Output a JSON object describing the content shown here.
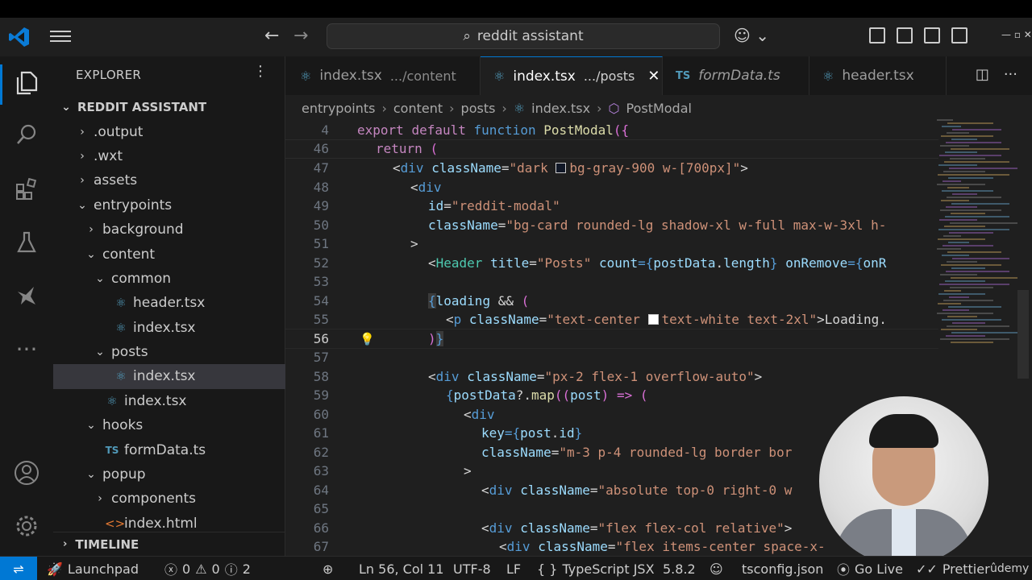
{
  "titlebar": {
    "search": "reddit assistant"
  },
  "explorer": {
    "header": "EXPLORER",
    "root": "REDDIT ASSISTANT",
    "items": [
      {
        "label": ".output",
        "depth": 0,
        "kind": "folder",
        "open": false
      },
      {
        "label": ".wxt",
        "depth": 0,
        "kind": "folder",
        "open": false
      },
      {
        "label": "assets",
        "depth": 0,
        "kind": "folder",
        "open": false
      },
      {
        "label": "entrypoints",
        "depth": 0,
        "kind": "folder",
        "open": true
      },
      {
        "label": "background",
        "depth": 1,
        "kind": "folder",
        "open": false
      },
      {
        "label": "content",
        "depth": 1,
        "kind": "folder",
        "open": true
      },
      {
        "label": "common",
        "depth": 2,
        "kind": "folder",
        "open": true
      },
      {
        "label": "header.tsx",
        "depth": 3,
        "kind": "react"
      },
      {
        "label": "index.tsx",
        "depth": 3,
        "kind": "react"
      },
      {
        "label": "posts",
        "depth": 2,
        "kind": "folder",
        "open": true
      },
      {
        "label": "index.tsx",
        "depth": 3,
        "kind": "react",
        "selected": true
      },
      {
        "label": "index.tsx",
        "depth": 2,
        "kind": "react"
      },
      {
        "label": "hooks",
        "depth": 1,
        "kind": "folder",
        "open": true
      },
      {
        "label": "formData.ts",
        "depth": 2,
        "kind": "ts"
      },
      {
        "label": "popup",
        "depth": 1,
        "kind": "folder",
        "open": true
      },
      {
        "label": "components",
        "depth": 2,
        "kind": "folder",
        "open": false
      },
      {
        "label": "index.html",
        "depth": 2,
        "kind": "html"
      }
    ],
    "timeline": "TIMELINE"
  },
  "tabs": [
    {
      "name": "index.tsx",
      "desc": ".../content",
      "icon": "react",
      "active": false
    },
    {
      "name": "index.tsx",
      "desc": ".../posts",
      "icon": "react",
      "active": true
    },
    {
      "name": "formData.ts",
      "desc": "",
      "icon": "ts",
      "active": false
    },
    {
      "name": "header.tsx",
      "desc": "",
      "icon": "react",
      "active": false
    }
  ],
  "breadcrumb": [
    "entrypoints",
    "content",
    "posts",
    "index.tsx",
    "PostModal"
  ],
  "code_lines": [
    {
      "n": "4",
      "sticky": true
    },
    {
      "n": "46",
      "sticky": true
    },
    {
      "n": "47"
    },
    {
      "n": "48"
    },
    {
      "n": "49"
    },
    {
      "n": "50"
    },
    {
      "n": "51"
    },
    {
      "n": "52"
    },
    {
      "n": "53"
    },
    {
      "n": "54"
    },
    {
      "n": "55"
    },
    {
      "n": "56",
      "current": true
    },
    {
      "n": "57"
    },
    {
      "n": "58"
    },
    {
      "n": "59"
    },
    {
      "n": "60"
    },
    {
      "n": "61"
    },
    {
      "n": "62"
    },
    {
      "n": "63"
    },
    {
      "n": "64"
    },
    {
      "n": "65"
    },
    {
      "n": "66"
    },
    {
      "n": "67"
    }
  ],
  "code_text": {
    "l4": [
      "export",
      "default",
      "function",
      "PostModal",
      "({"
    ],
    "l46": [
      "return",
      "("
    ],
    "l47": [
      "<",
      "div",
      "className",
      "=",
      "\"dark ",
      "bg-gray-900 w-[700px]\"",
      ">"
    ],
    "l48": [
      "<",
      "div"
    ],
    "l49": [
      "id",
      "=",
      "\"reddit-modal\""
    ],
    "l50": [
      "className",
      "=",
      "\"bg-card rounded-lg shadow-xl w-full max-w-3xl h-"
    ],
    "l51": [
      ">"
    ],
    "l52": [
      "<",
      "Header",
      "title",
      "=",
      "\"Posts\"",
      "count",
      "={",
      "postData",
      ".",
      "length",
      "}",
      "onRemove",
      "={",
      "onR"
    ],
    "l54": [
      "{",
      "loading",
      " && ",
      "("
    ],
    "l55": [
      "<",
      "p",
      "className",
      "=",
      "\"text-center ",
      "text-white text-2xl\"",
      ">",
      "Loading."
    ],
    "l56": [
      ")",
      "}"
    ],
    "l58": [
      "<",
      "div",
      "className",
      "=",
      "\"px-2 flex-1 overflow-auto\"",
      ">"
    ],
    "l59": [
      "{",
      "postData",
      "?.",
      "map",
      "((",
      "post",
      ") => ("
    ],
    "l60": [
      "<",
      "div"
    ],
    "l61": [
      "key",
      "={",
      "post",
      ".",
      "id",
      "}"
    ],
    "l62": [
      "className",
      "=",
      "\"m-3 p-4 rounded-lg border bor"
    ],
    "l63": [
      ">"
    ],
    "l64": [
      "<",
      "div",
      "className",
      "=",
      "\"absolute top-0 right-0 w"
    ],
    "l66": [
      "<",
      "div",
      "className",
      "=",
      "\"flex flex-col relative\"",
      ">"
    ],
    "l67": [
      "<",
      "div",
      "className",
      "=",
      "\"flex items-center space-x-"
    ]
  },
  "statusbar": {
    "launchpad": "Launchpad",
    "errors": "0",
    "warnings": "0",
    "infos": "2",
    "position": "Ln 56, Col 11",
    "encoding": "UTF-8",
    "eol": "LF",
    "language": "TypeScript JSX",
    "ts_version": "5.8.2",
    "config": "tsconfig.json",
    "golive": "Go Live",
    "prettier": "Prettier",
    "brand": "ûdemy"
  },
  "colors": {
    "accent": "#0078d4",
    "keyword": "#c586c0",
    "function": "#dcdcaa",
    "tag": "#569cd6",
    "attribute": "#9cdcfe",
    "string": "#ce9178"
  }
}
